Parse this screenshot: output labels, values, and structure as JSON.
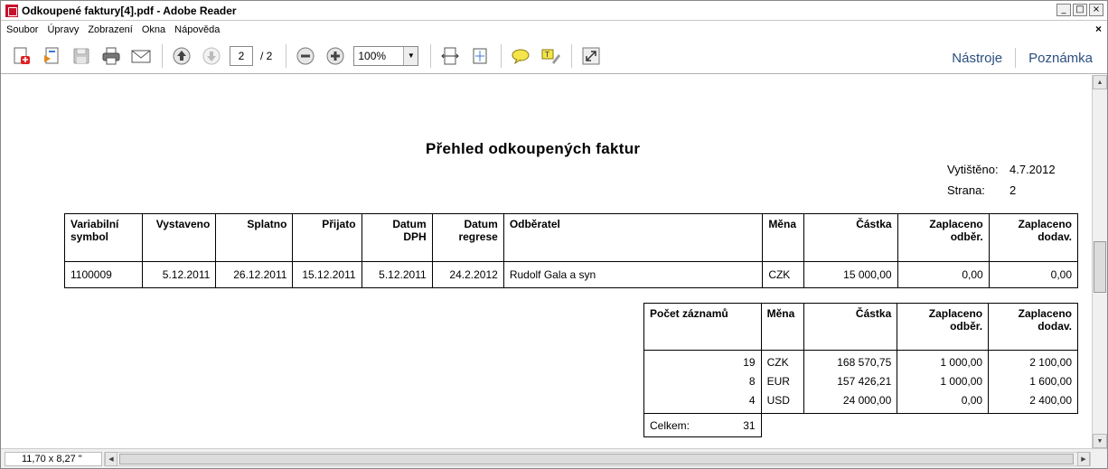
{
  "window": {
    "title": "Odkoupené faktury[4].pdf - Adobe Reader",
    "controls": {
      "minimize": "_",
      "maximize": "□",
      "close": "×"
    }
  },
  "menu": {
    "items": [
      "Soubor",
      "Úpravy",
      "Zobrazení",
      "Okna",
      "Nápověda"
    ],
    "close": "×"
  },
  "toolbar": {
    "icons": [
      "create-pdf-icon",
      "edit-icon",
      "save-icon",
      "print-icon",
      "email-icon",
      "prev-page-icon",
      "next-page-icon",
      "zoom-out-icon",
      "zoom-in-icon",
      "fit-width-icon",
      "fit-page-icon",
      "comment-icon",
      "highlight-icon",
      "fullscreen-icon"
    ],
    "page_current": "2",
    "page_total": "/ 2",
    "zoom": "100%",
    "tools_label": "Nástroje",
    "comment_label": "Poznámka"
  },
  "document": {
    "title": "Přehled odkoupených faktur",
    "printed_label": "Vytištěno:",
    "printed_value": "4.7.2012",
    "page_label": "Strana:",
    "page_value": "2",
    "table1": {
      "headers": {
        "variabilni": "Variabilní symbol",
        "vystaveno": "Vystaveno",
        "splatno": "Splatno",
        "prijato": "Přijato",
        "datum_dph": "Datum DPH",
        "datum_regrese": "Datum regrese",
        "odberatel": "Odběratel",
        "mena": "Měna",
        "castka": "Částka",
        "zapl_odber": "Zaplaceno odběr.",
        "zapl_dodav": "Zaplaceno dodav."
      },
      "row": {
        "variabilni": "1100009",
        "vystaveno": "5.12.2011",
        "splatno": "26.12.2011",
        "prijato": "15.12.2011",
        "datum_dph": "5.12.2011",
        "datum_regrese": "24.2.2012",
        "odberatel": "Rudolf Gala a syn",
        "mena": "CZK",
        "castka": "15 000,00",
        "zapl_odber": "0,00",
        "zapl_dodav": "0,00"
      }
    },
    "table2": {
      "headers": {
        "pocet": "Počet záznamů",
        "mena": "Měna",
        "castka": "Částka",
        "zapl_odber": "Zaplaceno odběr.",
        "zapl_dodav": "Zaplaceno dodav."
      },
      "rows": [
        {
          "pocet": "19",
          "mena": "CZK",
          "castka": "168 570,75",
          "zapl_odber": "1 000,00",
          "zapl_dodav": "2 100,00"
        },
        {
          "pocet": "8",
          "mena": "EUR",
          "castka": "157 426,21",
          "zapl_odber": "1 000,00",
          "zapl_dodav": "1 600,00"
        },
        {
          "pocet": "4",
          "mena": "USD",
          "castka": "24 000,00",
          "zapl_odber": "0,00",
          "zapl_dodav": "2 400,00"
        }
      ],
      "total_label": "Celkem:",
      "total_value": "31"
    }
  },
  "status": {
    "page_size": "11,70 x 8,27 \""
  }
}
